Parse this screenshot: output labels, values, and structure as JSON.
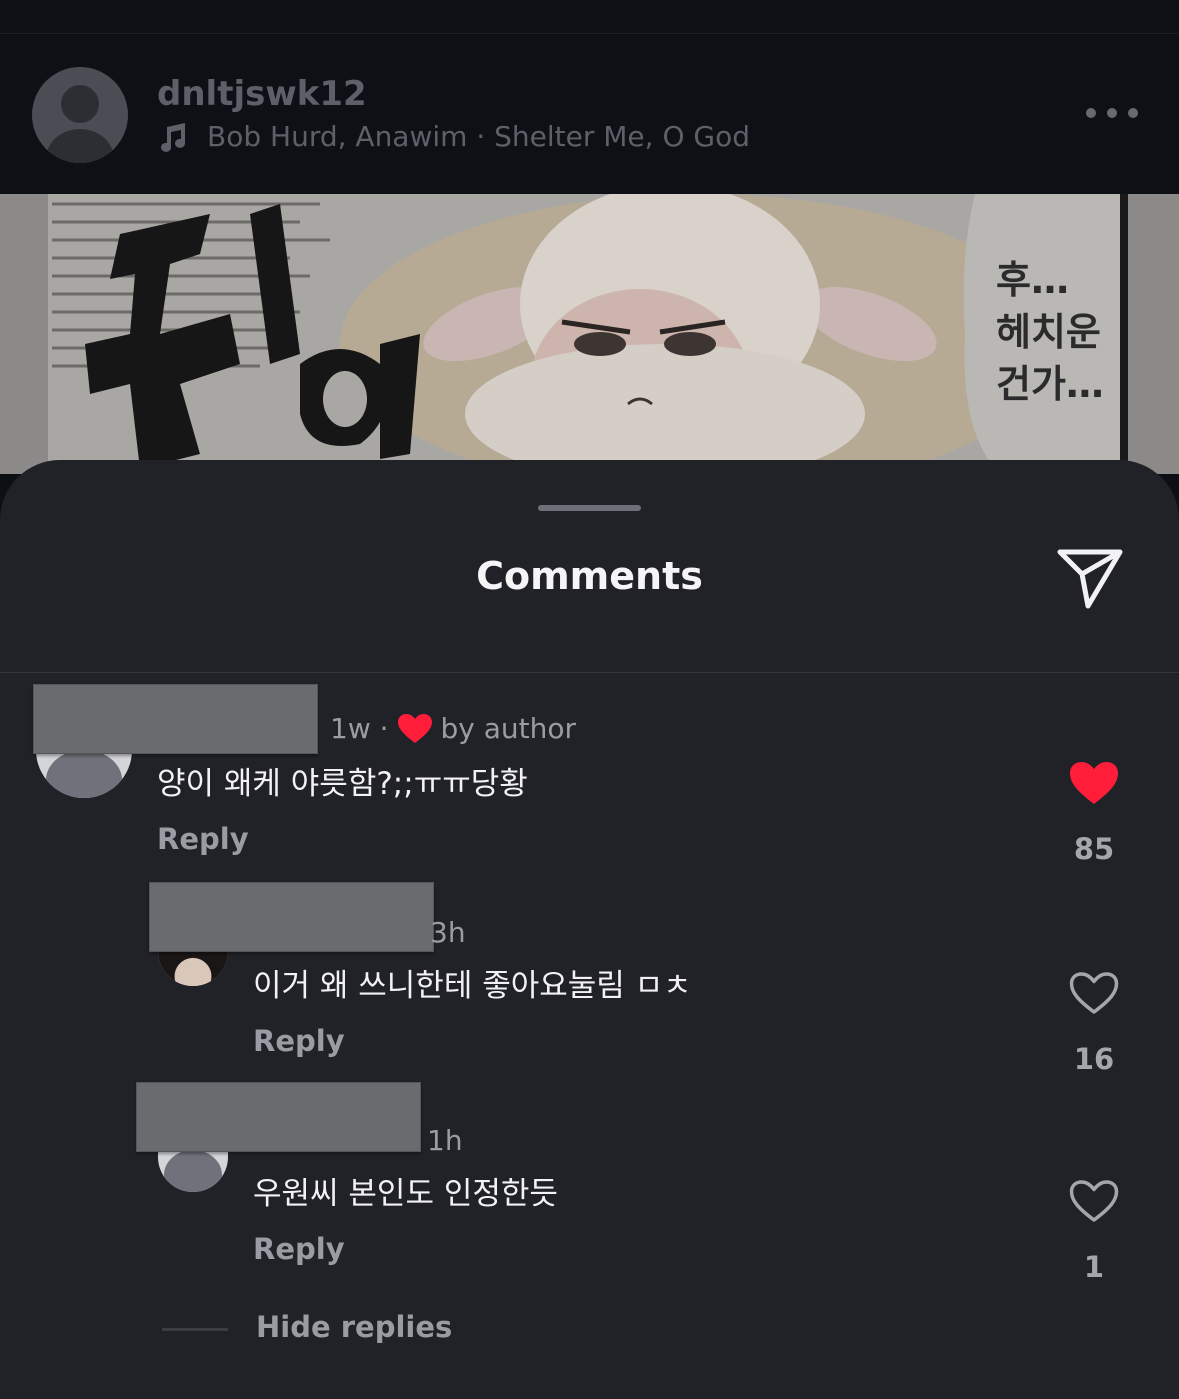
{
  "post": {
    "username": "dnltjswk12",
    "music": "Bob Hurd, Anawim · Shelter Me, O God",
    "comic_text": [
      "후…",
      "헤치운",
      "건가…"
    ]
  },
  "sheet": {
    "title": "Comments"
  },
  "comments": [
    {
      "time": "1w ·",
      "liked_by_author": "by author",
      "text": "양이 왜케 야릇함?;;ㅠㅠ당황",
      "reply_label": "Reply",
      "like_count": "85",
      "liked": true
    },
    {
      "time": "3h",
      "text": "이거 왜 쓰니한테 좋아요눌림 ㅁㅊ",
      "reply_label": "Reply",
      "like_count": "16",
      "liked": false
    },
    {
      "time": "1h",
      "text": "우원씨 본인도 인정한듯",
      "reply_label": "Reply",
      "like_count": "1",
      "liked": false
    }
  ],
  "hide_replies_label": "Hide replies",
  "colors": {
    "sheet_bg": "#202228",
    "like_red": "#ff1d3a",
    "muted_text": "#9a9ca3"
  }
}
